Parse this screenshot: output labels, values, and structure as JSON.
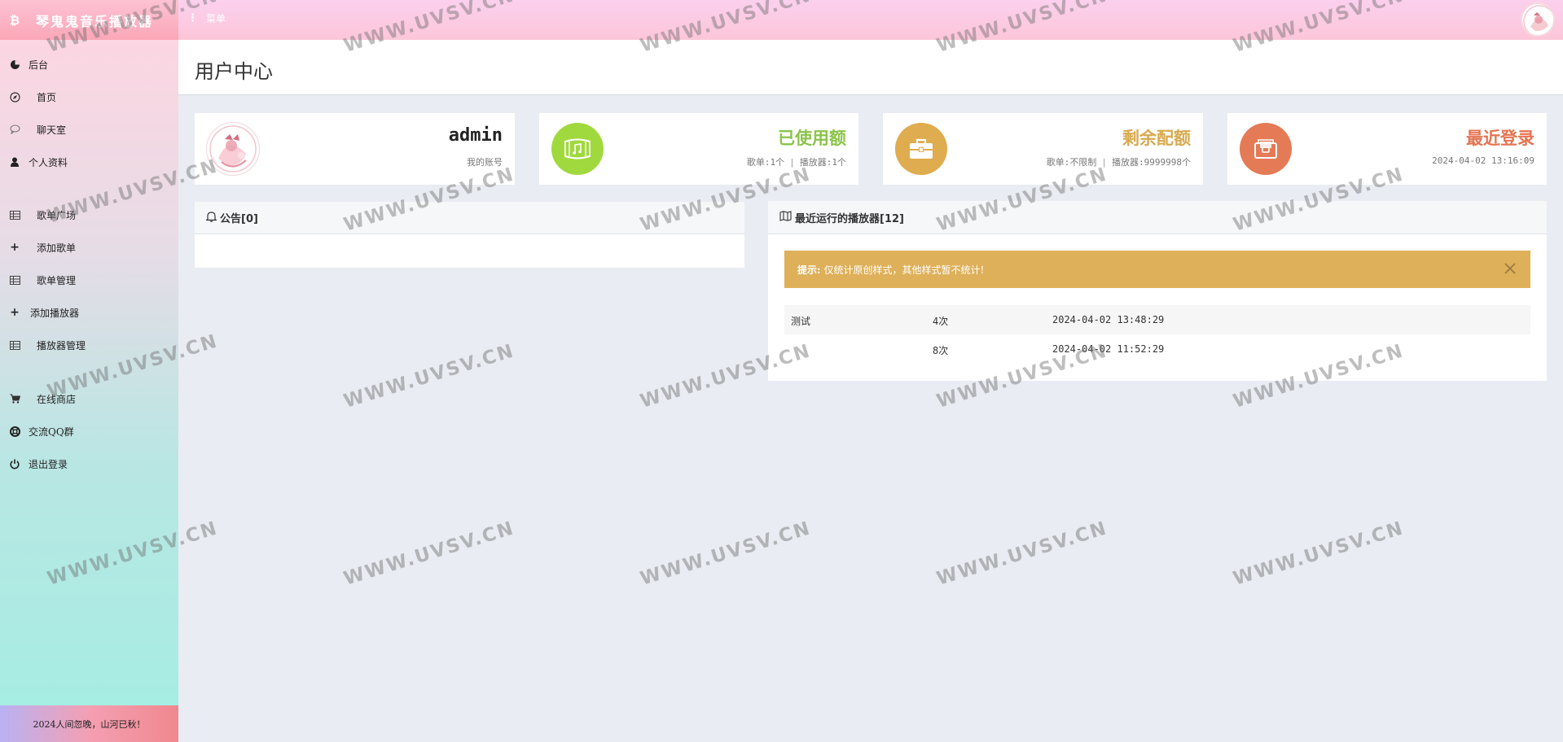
{
  "brand": {
    "title": "琴鬼鬼音乐播放器",
    "icon": "bitcoin-icon"
  },
  "topbar": {
    "menu_label": "菜单"
  },
  "sidebar": {
    "items": [
      {
        "label": "后台",
        "icon": "pie-chart-icon"
      },
      {
        "label": "首页",
        "icon": "compass-icon"
      },
      {
        "label": "聊天室",
        "icon": "chat-icon"
      },
      {
        "label": "个人资料",
        "icon": "user-icon"
      },
      {
        "label": "歌单广场",
        "icon": "table-icon"
      },
      {
        "label": "添加歌单",
        "icon": "plus-icon"
      },
      {
        "label": "歌单管理",
        "icon": "table-icon"
      },
      {
        "label": "添加播放器",
        "icon": "plus-icon"
      },
      {
        "label": "播放器管理",
        "icon": "table-icon"
      },
      {
        "label": "在线商店",
        "icon": "cart-icon"
      },
      {
        "label": "交流QQ群",
        "icon": "lifebuoy-icon"
      },
      {
        "label": "退出登录",
        "icon": "power-icon"
      }
    ],
    "footer": "2024人间忽晚，山河已秋！"
  },
  "page": {
    "title": "用户中心"
  },
  "cards": {
    "account": {
      "title": "admin",
      "sub": "我的账号"
    },
    "used": {
      "title": "已使用额",
      "sub_a": "歌单:1个",
      "sub_b": "播放器:1个",
      "color": "#8bc34a",
      "circle": "#a0d93d"
    },
    "remaining": {
      "title": "剩余配额",
      "sub_a": "歌单:不限制",
      "sub_b": "播放器:9999998个",
      "color": "#d8a94e",
      "circle": "#dfac4f"
    },
    "last_login": {
      "title": "最近登录",
      "sub": "2024-04-02 13:16:09",
      "color": "#e57452",
      "circle": "#e47b56"
    }
  },
  "notice": {
    "title": "公告[0]"
  },
  "players": {
    "title": "最近运行的播放器[12]",
    "alert_label": "提示:",
    "alert_text": "仅统计原创样式，其他样式暂不统计!",
    "rows": [
      {
        "name": "测试",
        "count": "4次",
        "time": "2024-04-02 13:48:29"
      },
      {
        "name": "",
        "count": "8次",
        "time": "2024-04-02 11:52:29"
      }
    ]
  },
  "watermark": "WWW.UVSV.CN"
}
